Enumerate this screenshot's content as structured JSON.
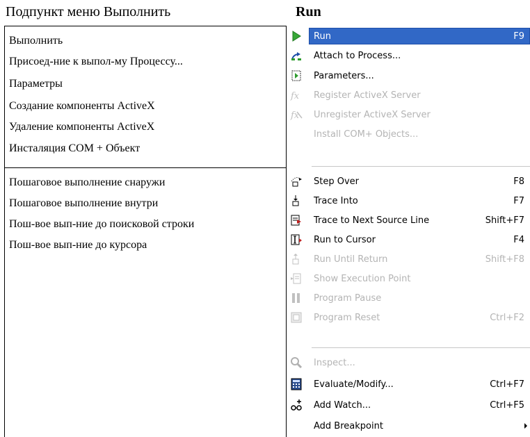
{
  "headers": {
    "left_title": "Подпункт меню Выполнить",
    "right_title": "Run"
  },
  "left": {
    "group1": [
      "Выполнить",
      "Присоед-ние к выпол-му Процессу...",
      "Параметры",
      "Создание компоненты ActiveX",
      "Удаление компоненты ActiveX",
      "Инсталяция COM + Объект"
    ],
    "group2": [
      "Пошаговое выполнение снаружи",
      "Пошаговое выполнение внутри",
      "Пош-вое вып-ние до поисковой строки",
      "Пош-вое вып-ние до курсора"
    ]
  },
  "menu": {
    "items": [
      {
        "label": "Run",
        "shortcut": "F9",
        "icon": "run-play-icon",
        "state": "selected"
      },
      {
        "label": "Attach to Process...",
        "shortcut": "",
        "icon": "attach-process-icon",
        "state": "enabled"
      },
      {
        "label": "Parameters...",
        "shortcut": "",
        "icon": "parameters-icon",
        "state": "enabled"
      },
      {
        "label": "Register ActiveX Server",
        "shortcut": "",
        "icon": "register-activex-icon",
        "state": "disabled"
      },
      {
        "label": "Unregister ActiveX Server",
        "shortcut": "",
        "icon": "unregister-activex-icon",
        "state": "disabled"
      },
      {
        "label": "Install COM+ Objects...",
        "shortcut": "",
        "icon": "",
        "state": "disabled"
      },
      {
        "label": "Step Over",
        "shortcut": "F8",
        "icon": "step-over-icon",
        "state": "enabled"
      },
      {
        "label": "Trace Into",
        "shortcut": "F7",
        "icon": "trace-into-icon",
        "state": "enabled"
      },
      {
        "label": "Trace to Next Source Line",
        "shortcut": "Shift+F7",
        "icon": "trace-next-line-icon",
        "state": "enabled"
      },
      {
        "label": "Run to Cursor",
        "shortcut": "F4",
        "icon": "run-to-cursor-icon",
        "state": "enabled"
      },
      {
        "label": "Run Until Return",
        "shortcut": "Shift+F8",
        "icon": "run-until-return-icon",
        "state": "disabled"
      },
      {
        "label": "Show Execution Point",
        "shortcut": "",
        "icon": "show-execution-point-icon",
        "state": "disabled"
      },
      {
        "label": "Program Pause",
        "shortcut": "",
        "icon": "pause-icon",
        "state": "disabled"
      },
      {
        "label": "Program Reset",
        "shortcut": "Ctrl+F2",
        "icon": "reset-icon",
        "state": "disabled"
      },
      {
        "label": "Inspect...",
        "shortcut": "",
        "icon": "inspect-icon",
        "state": "disabled"
      },
      {
        "label": "Evaluate/Modify...",
        "shortcut": "Ctrl+F7",
        "icon": "evaluate-modify-icon",
        "state": "enabled"
      },
      {
        "label": "Add Watch...",
        "shortcut": "Ctrl+F5",
        "icon": "add-watch-icon",
        "state": "enabled"
      },
      {
        "label": "Add Breakpoint",
        "shortcut": "",
        "icon": "",
        "state": "enabled",
        "submenu": true
      }
    ]
  },
  "colors": {
    "highlight": "#3168c6",
    "disabled_text": "#b4b4b4"
  }
}
